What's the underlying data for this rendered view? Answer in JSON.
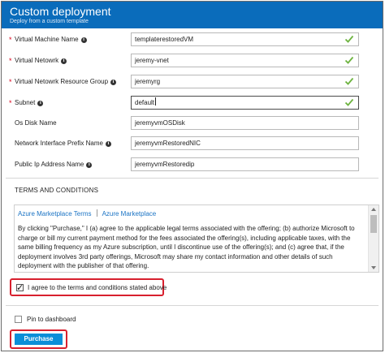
{
  "header": {
    "title": "Custom deployment",
    "subtitle": "Deploy from a custom template"
  },
  "fields": [
    {
      "label": "Virtual Machine Name",
      "required": true,
      "value": "templaterestoredVM",
      "valid": true
    },
    {
      "label": "Virtual Netowrk",
      "required": true,
      "value": "jeremy-vnet",
      "valid": true
    },
    {
      "label": "Virtual Netowrk Resource Group",
      "required": true,
      "value": "jeremyrg",
      "valid": true
    },
    {
      "label": "Subnet",
      "required": true,
      "value": "default",
      "valid": true
    },
    {
      "label": "Os Disk Name",
      "required": false,
      "value": "jeremyvmOSDisk",
      "valid": false
    },
    {
      "label": "Network Interface Prefix Name",
      "required": false,
      "value": "jeremyvmRestoredNIC",
      "valid": false
    },
    {
      "label": "Public Ip Address Name",
      "required": false,
      "value": "jeremyvmRestoredip",
      "valid": false
    }
  ],
  "terms": {
    "heading": "TERMS AND CONDITIONS",
    "link1": "Azure Marketplace Terms",
    "link2": "Azure Marketplace",
    "body": "By clicking \"Purchase,\" I (a) agree to the applicable legal terms associated with the offering; (b) authorize Microsoft to charge or bill my current payment method for the fees associated the offering(s), including applicable taxes, with the same billing frequency as my Azure subscription, until I discontinue use of the offering(s); and (c) agree that, if the deployment involves 3rd party offerings, Microsoft may share my contact information and other details of such deployment with the publisher of that offering.",
    "agree_label": "I agree to the terms and conditions stated above",
    "agree_checked": true
  },
  "footer": {
    "pin_label": "Pin to dashboard",
    "pin_checked": false,
    "purchase_label": "Purchase"
  },
  "colors": {
    "header_bg": "#0a6cbb",
    "valid_check": "#6db33f",
    "highlight_border": "#d8202e",
    "purchase_bg": "#0b8ed8",
    "link": "#1a73c4"
  },
  "icons": {
    "info": "info-icon",
    "valid": "checkmark-icon"
  }
}
